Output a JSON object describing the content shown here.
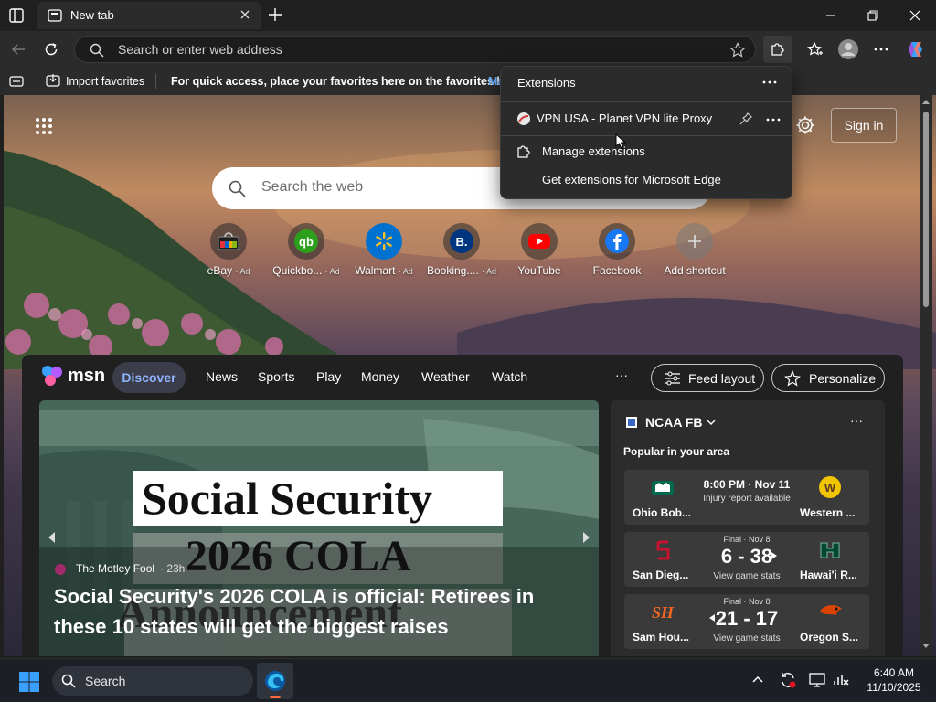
{
  "window": {
    "tab_title": "New tab"
  },
  "navbar": {
    "address_placeholder": "Search or enter web address"
  },
  "favorites_bar": {
    "import_label": "Import favorites",
    "hint_text": "For quick access, place your favorites here on the favorites bar.",
    "hint_link_fragment": "Ma"
  },
  "newtab": {
    "search_placeholder": "Search the web",
    "sign_in_label": "Sign in",
    "tiles": [
      {
        "label": "eBay",
        "ad": "· Ad",
        "icon": "ebay-icon"
      },
      {
        "label": "Quickbo...",
        "ad": "· Ad",
        "icon": "quickbooks-icon"
      },
      {
        "label": "Walmart",
        "ad": "· Ad",
        "icon": "walmart-icon"
      },
      {
        "label": "Booking....",
        "ad": "· Ad",
        "icon": "booking-icon"
      },
      {
        "label": "YouTube",
        "ad": "",
        "icon": "youtube-icon"
      },
      {
        "label": "Facebook",
        "ad": "",
        "icon": "facebook-icon"
      },
      {
        "label": "Add shortcut",
        "ad": "",
        "icon": "plus-icon"
      }
    ]
  },
  "msn": {
    "brand": "msn",
    "nav": [
      "Discover",
      "News",
      "Sports",
      "Play",
      "Money",
      "Weather",
      "Watch"
    ],
    "more": "···",
    "feed_layout_label": "Feed layout",
    "personalize_label": "Personalize",
    "hero": {
      "image_line1": "Social Security",
      "image_line2": "2026 COLA",
      "image_line3": "Announcement",
      "source": "The Motley Fool",
      "age": "· 23h",
      "headline": "Social Security's 2026 COLA is official: Retirees in these 10 states will get the biggest raises"
    },
    "sports": {
      "league": "NCAA FB",
      "subtitle": "Popular in your area",
      "games": [
        {
          "team1": "Ohio Bob...",
          "team2": "Western ...",
          "line1": "8:00 PM · Nov 11",
          "line2": "Injury report available",
          "score": "",
          "status": ""
        },
        {
          "team1": "San Dieg...",
          "team2": "Hawai'i R...",
          "line1": "",
          "line2": "View game stats",
          "score": "6 - 38",
          "status": "Final · Nov 8"
        },
        {
          "team1": "Sam Hou...",
          "team2": "Oregon S...",
          "line1": "",
          "line2": "View game stats",
          "score": "21 - 17",
          "status": "Final · Nov 8"
        }
      ]
    }
  },
  "extensions_popup": {
    "title": "Extensions",
    "item": "VPN USA - Planet VPN lite Proxy",
    "manage": "Manage extensions",
    "get": "Get extensions for Microsoft Edge"
  },
  "taskbar": {
    "search_label": "Search",
    "time": "6:40 AM",
    "date": "11/10/2025"
  },
  "colors": {
    "edge_accent": "#3b82f6",
    "discover_text": "#8fb4ff"
  }
}
